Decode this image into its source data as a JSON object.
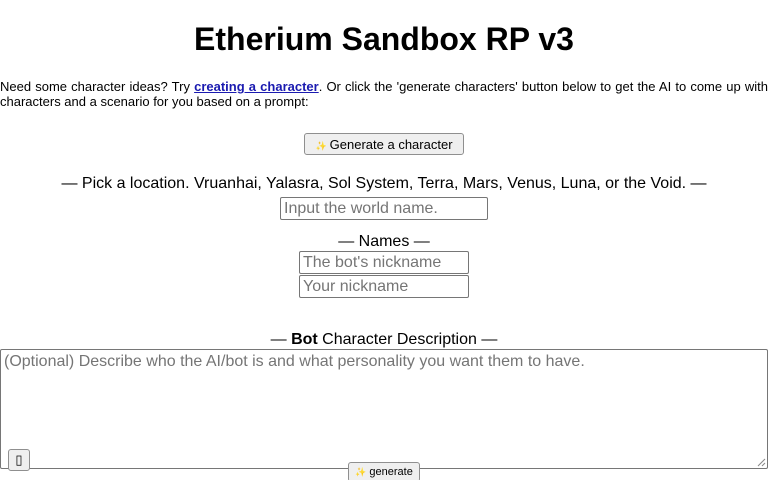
{
  "page": {
    "title": "Etherium Sandbox RP v3"
  },
  "intro": {
    "before_link": "Need some character ideas? Try ",
    "link_text": "creating a character",
    "after_link": ". Or click the 'generate characters' button below to get the AI to come up with characters and a scenario for you based on a prompt:"
  },
  "generate_character_button": {
    "icon": "sparkle-icon",
    "icon_glyph": "✨",
    "label": "Generate a character"
  },
  "location": {
    "label": "— Pick a location. Vruanhai, Yalasra, Sol System, Terra, Mars, Venus, Luna, or the Void. —",
    "placeholder": "Input the world name.",
    "value": ""
  },
  "names": {
    "label": "— Names —",
    "bot_placeholder": "The bot's nickname",
    "user_placeholder": "Your nickname",
    "bot_value": "",
    "user_value": ""
  },
  "bot_description": {
    "label_prefix": "— ",
    "label_bold": "Bot",
    "label_suffix": " Character Description —",
    "placeholder": "(Optional) Describe who the AI/bot is and what personality you want them to have.",
    "value": ""
  },
  "small_button": {
    "icon": "missing-glyph-icon",
    "glyph": "▯"
  },
  "generate_button": {
    "icon": "sparkle-icon",
    "icon_glyph": "✨",
    "label": "generate"
  },
  "colors": {
    "link": "#1a1ab0",
    "button_bg": "#efefef",
    "border": "#767676",
    "placeholder": "#757575"
  }
}
